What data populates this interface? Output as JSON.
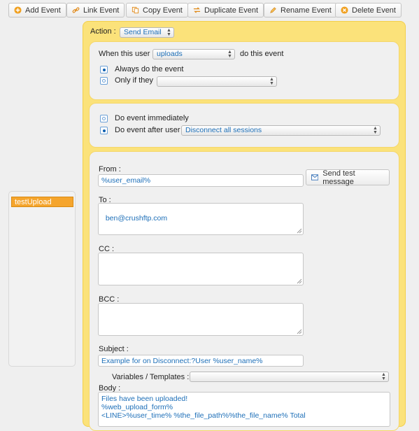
{
  "toolbar": {
    "add_event": "Add Event",
    "link_event": "Link Event",
    "copy_event": "Copy Event",
    "duplicate_event": "Duplicate Event",
    "rename_event": "Rename Event",
    "delete_event": "Delete Event"
  },
  "events": {
    "items": [
      "testUpload"
    ],
    "selected": "testUpload"
  },
  "action": {
    "label": "Action :",
    "value": "Send Email"
  },
  "trigger": {
    "when_label": "When this user",
    "when_value": "uploads",
    "do_label": "do this event",
    "always_label": "Always do the event",
    "only_if_label": "Only if they",
    "only_if_value": "",
    "always_selected": true
  },
  "timing": {
    "immediately_label": "Do event immediately",
    "after_label": "Do event after user",
    "after_value": "Disconnect all sessions",
    "after_selected": true
  },
  "email": {
    "from_label": "From :",
    "from_value": "%user_email%",
    "send_test_label": "Send test message",
    "to_label": "To :",
    "to_value": "ben@crushftp.com",
    "cc_label": "CC :",
    "cc_value": "",
    "bcc_label": "BCC :",
    "bcc_value": "",
    "subject_label": "Subject :",
    "subject_value": "Example for on Disconnect:?User %user_name%",
    "variables_label": "Variables / Templates :",
    "variables_value": "",
    "body_label": "Body :",
    "body_value": "Files have been uploaded!\n%web_upload_form%\n<LINE>%user_time% %the_file_path%%the_file_name% Total"
  },
  "colors": {
    "accent_blue": "#1d6fb8",
    "panel_yellow": "#fbe27a",
    "selected_orange": "#f5a52d"
  },
  "icons": {
    "add": "plus-circle-icon",
    "link": "link-icon",
    "copy": "copy-icon",
    "duplicate": "duplicate-arrows-icon",
    "rename": "pencil-icon",
    "delete": "delete-x-icon",
    "send": "envelope-icon"
  }
}
